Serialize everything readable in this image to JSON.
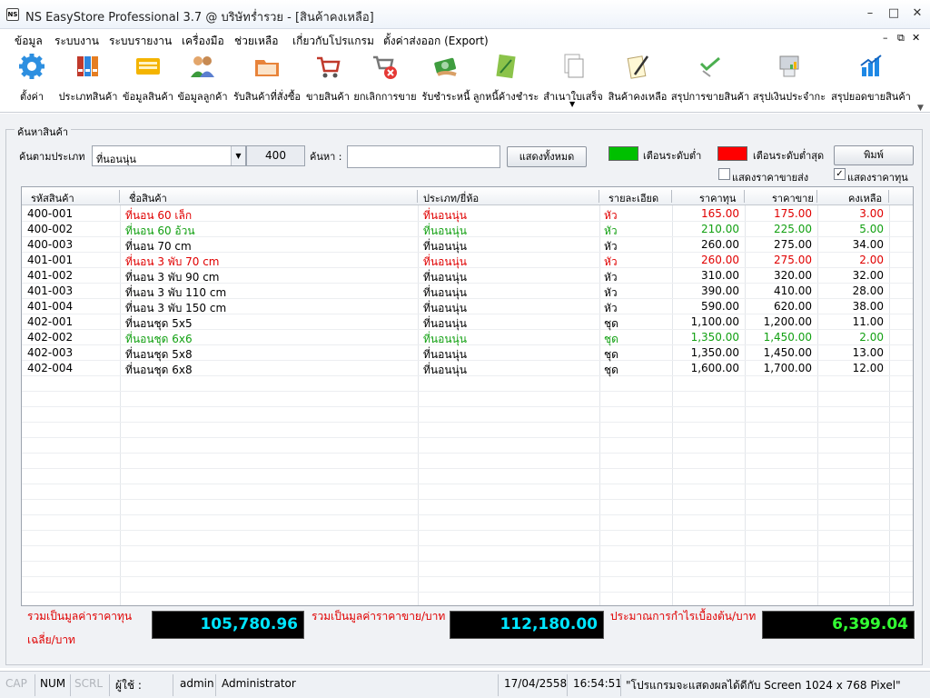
{
  "window": {
    "title": "NS EasyStore Professional 3.7 @ บริษัทร่ำรวย - [สินค้าคงเหลือ]",
    "icon_text": "NS"
  },
  "menu": [
    "ข้อมูล",
    "ระบบงาน",
    "ระบบรายงาน",
    "เครื่องมือ",
    "ช่วยเหลือ",
    "เกี่ยวกับโปรแกรม",
    "ตั้งค่าส่งออก (Export)"
  ],
  "toolbar": [
    {
      "label": "ตั้งค่า",
      "icon": "gear-icon"
    },
    {
      "label": "ประเภทสินค้า",
      "icon": "binders-icon"
    },
    {
      "label": "ข้อมูลสินค้า",
      "icon": "keyboard-icon"
    },
    {
      "label": "ข้อมูลลูกค้า",
      "icon": "users-icon"
    },
    {
      "label": "รับสินค้าที่สั่งซื้อ",
      "icon": "folder-icon"
    },
    {
      "label": "ขายสินค้า",
      "icon": "cart-icon"
    },
    {
      "label": "ยกเลิกการขาย",
      "icon": "cart-cancel-icon"
    },
    {
      "label": "รับชำระหนี้",
      "icon": "payment-icon"
    },
    {
      "label": "ลูกหนี้ค้างชำระ",
      "icon": "ledger-icon"
    },
    {
      "label": "สำเนาใบเสร็จ",
      "icon": "documents-icon"
    },
    {
      "label": "สินค้าคงเหลือ",
      "icon": "note-pen-icon"
    },
    {
      "label": "สรุปการขายสินค้า",
      "icon": "checklist-icon"
    },
    {
      "label": "สรุปเงินประจำกะ",
      "icon": "pos-terminal-icon"
    },
    {
      "label": "สรุปยอดขายสินค้า",
      "icon": "bar-chart-icon"
    }
  ],
  "search": {
    "group_title": "ค้นหาสินค้า",
    "category_label": "ค้นตามประเภท",
    "category_value": "ที่นอนนุ่น",
    "category_code": "400",
    "search_label": "ค้นหา :",
    "search_value": "",
    "show_all_button": "แสดงทั้งหมด",
    "warn_level_label": "เตือนระดับต่ำ",
    "warn_min_label": "เตือนระดับต่ำสุด",
    "print_button": "พิมพ์",
    "show_wholesale_label": "แสดงราคาขายส่ง",
    "show_wholesale_checked": false,
    "show_cost_label": "แสดงราคาทุน",
    "show_cost_checked": true,
    "warn_level_color": "#00c000",
    "warn_min_color": "#ff0000"
  },
  "table": {
    "columns": [
      "รหัสสินค้า",
      "ชื่อสินค้า",
      "ประเภท/ยี่ห้อ",
      "รายละเอียด",
      "ราคาทุน",
      "ราคาขาย",
      "คงเหลือ"
    ],
    "rows": [
      {
        "code": "400-001",
        "name": "ที่นอน 60 เล็ก",
        "category": "ที่นอนนุ่น",
        "unit": "หัว",
        "cost": "165.00",
        "price": "175.00",
        "stock": "3.00",
        "status": "red"
      },
      {
        "code": "400-002",
        "name": "ที่นอน 60 อ้วน",
        "category": "ที่นอนนุ่น",
        "unit": "หัว",
        "cost": "210.00",
        "price": "225.00",
        "stock": "5.00",
        "status": "green"
      },
      {
        "code": "400-003",
        "name": "ที่นอน 70 cm",
        "category": "ที่นอนนุ่น",
        "unit": "หัว",
        "cost": "260.00",
        "price": "275.00",
        "stock": "34.00",
        "status": "black"
      },
      {
        "code": "401-001",
        "name": "ที่นอน 3 พับ 70 cm",
        "category": "ที่นอนนุ่น",
        "unit": "หัว",
        "cost": "260.00",
        "price": "275.00",
        "stock": "2.00",
        "status": "red"
      },
      {
        "code": "401-002",
        "name": "ที่นอน 3 พับ 90 cm",
        "category": "ที่นอนนุ่น",
        "unit": "หัว",
        "cost": "310.00",
        "price": "320.00",
        "stock": "32.00",
        "status": "black"
      },
      {
        "code": "401-003",
        "name": "ที่นอน 3 พับ 110 cm",
        "category": "ที่นอนนุ่น",
        "unit": "หัว",
        "cost": "390.00",
        "price": "410.00",
        "stock": "28.00",
        "status": "black"
      },
      {
        "code": "401-004",
        "name": "ที่นอน 3 พับ 150 cm",
        "category": "ที่นอนนุ่น",
        "unit": "หัว",
        "cost": "590.00",
        "price": "620.00",
        "stock": "38.00",
        "status": "black"
      },
      {
        "code": "402-001",
        "name": "ที่นอนชุด 5x5",
        "category": "ที่นอนนุ่น",
        "unit": "ชุด",
        "cost": "1,100.00",
        "price": "1,200.00",
        "stock": "11.00",
        "status": "black"
      },
      {
        "code": "402-002",
        "name": "ที่นอนชุด 6x6",
        "category": "ที่นอนนุ่น",
        "unit": "ชุด",
        "cost": "1,350.00",
        "price": "1,450.00",
        "stock": "2.00",
        "status": "green"
      },
      {
        "code": "402-003",
        "name": "ที่นอนชุด 5x8",
        "category": "ที่นอนนุ่น",
        "unit": "ชุด",
        "cost": "1,350.00",
        "price": "1,450.00",
        "stock": "13.00",
        "status": "black"
      },
      {
        "code": "402-004",
        "name": "ที่นอนชุด 6x8",
        "category": "ที่นอนนุ่น",
        "unit": "ชุด",
        "cost": "1,600.00",
        "price": "1,700.00",
        "stock": "12.00",
        "status": "black"
      }
    ]
  },
  "summary": {
    "cost_label_line1": "รวมเป็นมูลค่าราคาทุน",
    "cost_label_line2": "เฉลี่ย/บาท",
    "cost_value": "105,780.96",
    "cost_color": "#00e5ff",
    "sale_label": "รวมเป็นมูลค่าราคาขาย/บาท",
    "sale_value": "112,180.00",
    "sale_color": "#00e5ff",
    "profit_label": "ประมาณการกำไรเบื้องต้น/บาท",
    "profit_value": "6,399.04",
    "profit_color": "#33ff33"
  },
  "status": {
    "cap": "CAP",
    "num": "NUM",
    "scrl": "SCRL",
    "user_label": "ผู้ใช้ :",
    "username": "admin",
    "role": "Administrator",
    "date": "17/04/2558",
    "time": "16:54:51",
    "message": "\"โปรแกรมจะแสดงผลได้ดีกับ Screen 1024 x 768 Pixel\""
  }
}
